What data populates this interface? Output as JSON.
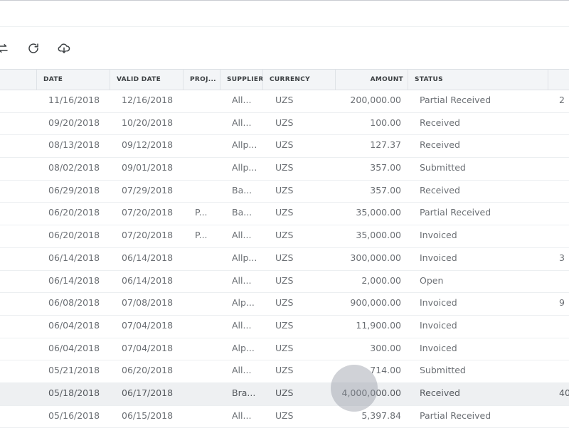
{
  "toolbar": {
    "buttons": [
      {
        "icon": "swap-icon"
      },
      {
        "icon": "refresh-icon"
      },
      {
        "icon": "cloud-download-icon"
      }
    ]
  },
  "table": {
    "columns": [
      "DATE",
      "VALID DATE",
      "PROJ...",
      "SUPPLIER",
      "CURRENCY",
      "AMOUNT",
      "STATUS"
    ],
    "rows": [
      {
        "date": "11/16/2018",
        "valid": "12/16/2018",
        "proj": "",
        "supplier": "All...",
        "currency": "UZS",
        "amount": "200,000.00",
        "status": "Partial Received",
        "extra": "2"
      },
      {
        "date": "09/20/2018",
        "valid": "10/20/2018",
        "proj": "",
        "supplier": "All...",
        "currency": "UZS",
        "amount": "100.00",
        "status": "Received",
        "extra": ""
      },
      {
        "date": "08/13/2018",
        "valid": "09/12/2018",
        "proj": "",
        "supplier": "Allp...",
        "currency": "UZS",
        "amount": "127.37",
        "status": "Received",
        "extra": ""
      },
      {
        "date": "08/02/2018",
        "valid": "09/01/2018",
        "proj": "",
        "supplier": "Allp...",
        "currency": "UZS",
        "amount": "357.00",
        "status": "Submitted",
        "extra": ""
      },
      {
        "date": "06/29/2018",
        "valid": "07/29/2018",
        "proj": "",
        "supplier": "Ba...",
        "currency": "UZS",
        "amount": "357.00",
        "status": "Received",
        "extra": ""
      },
      {
        "date": "06/20/2018",
        "valid": "07/20/2018",
        "proj": "P...",
        "supplier": "Ba...",
        "currency": "UZS",
        "amount": "35,000.00",
        "status": "Partial Received",
        "extra": ""
      },
      {
        "date": "06/20/2018",
        "valid": "07/20/2018",
        "proj": "P...",
        "supplier": "All...",
        "currency": "UZS",
        "amount": "35,000.00",
        "status": "Invoiced",
        "extra": ""
      },
      {
        "date": "06/14/2018",
        "valid": "06/14/2018",
        "proj": "",
        "supplier": "Allp...",
        "currency": "UZS",
        "amount": "300,000.00",
        "status": "Invoiced",
        "extra": "3"
      },
      {
        "date": "06/14/2018",
        "valid": "06/14/2018",
        "proj": "",
        "supplier": "All...",
        "currency": "UZS",
        "amount": "2,000.00",
        "status": "Open",
        "extra": ""
      },
      {
        "date": "06/08/2018",
        "valid": "07/08/2018",
        "proj": "",
        "supplier": "Alp...",
        "currency": "UZS",
        "amount": "900,000.00",
        "status": "Invoiced",
        "extra": "9"
      },
      {
        "date": "06/04/2018",
        "valid": "07/04/2018",
        "proj": "",
        "supplier": "All...",
        "currency": "UZS",
        "amount": "11,900.00",
        "status": "Invoiced",
        "extra": ""
      },
      {
        "date": "06/04/2018",
        "valid": "07/04/2018",
        "proj": "",
        "supplier": "Alp...",
        "currency": "UZS",
        "amount": "300.00",
        "status": "Invoiced",
        "extra": ""
      },
      {
        "date": "05/21/2018",
        "valid": "06/20/2018",
        "proj": "",
        "supplier": "All...",
        "currency": "UZS",
        "amount": "714.00",
        "status": "Submitted",
        "extra": ""
      },
      {
        "date": "05/18/2018",
        "valid": "06/17/2018",
        "proj": "",
        "supplier": "Bra...",
        "currency": "UZS",
        "amount": "4,000,000.00",
        "status": "Received",
        "extra": "40"
      },
      {
        "date": "05/16/2018",
        "valid": "06/15/2018",
        "proj": "",
        "supplier": "All...",
        "currency": "UZS",
        "amount": "5,397.84",
        "status": "Partial Received",
        "extra": ""
      }
    ],
    "highlighted_row": 13
  }
}
